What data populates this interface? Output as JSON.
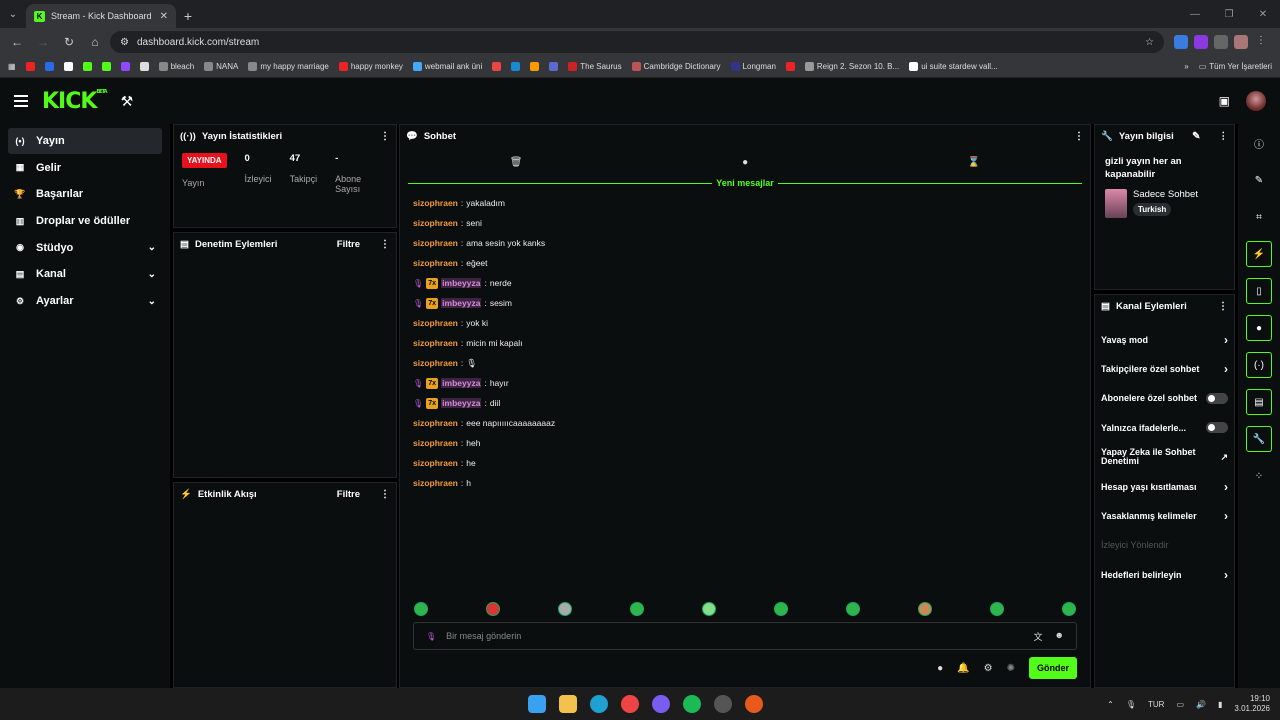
{
  "browser": {
    "tab_title": "Stream - Kick Dashboard",
    "url": "dashboard.kick.com/stream",
    "bookmarks": [
      "bleach",
      "NANA",
      "my happy marriage",
      "happy monkey",
      "webmail ank üni",
      "The Saurus",
      "Cambridge Dictionary",
      "Longman",
      "Reign 2. Sezon 10. B...",
      "ui suite stardew vall..."
    ],
    "all_bookmarks": "Tüm Yer İşaretleri"
  },
  "header": {
    "logo": "KICK",
    "beta": "BETA"
  },
  "nav": {
    "items": [
      {
        "label": "Yayın"
      },
      {
        "label": "Gelir"
      },
      {
        "label": "Başarılar"
      },
      {
        "label": "Droplar ve ödüller"
      },
      {
        "label": "Stüdyo"
      },
      {
        "label": "Kanal"
      },
      {
        "label": "Ayarlar"
      }
    ]
  },
  "stats": {
    "title": "Yayın İstatistikleri",
    "live_badge": "YAYINDA",
    "stream_label": "Yayın",
    "viewers": "0",
    "viewers_label": "İzleyici",
    "followers": "47",
    "followers_label": "Takipçi",
    "subs": "-",
    "subs_label": "Abone Sayısı"
  },
  "moderation": {
    "title": "Denetim Eylemleri",
    "filter": "Filtre"
  },
  "activity": {
    "title": "Etkinlik Akışı",
    "filter": "Filtre"
  },
  "chat": {
    "title": "Sohbet",
    "new_messages": "Yeni mesajlar",
    "messages": [
      {
        "user": "sizophraen",
        "text": "yakaladım",
        "type": "a"
      },
      {
        "user": "sizophraen",
        "text": "seni",
        "type": "a"
      },
      {
        "user": "sizophraen",
        "text": "ama sesin yok kanks",
        "type": "a"
      },
      {
        "user": "sizophraen",
        "text": "eğeet",
        "type": "a"
      },
      {
        "user": "imbeyyza",
        "text": "nerde",
        "type": "b"
      },
      {
        "user": "imbeyyza",
        "text": "sesim",
        "type": "b"
      },
      {
        "user": "sizophraen",
        "text": "yok ki",
        "type": "a"
      },
      {
        "user": "sizophraen",
        "text": "micin mi kapalı",
        "type": "a"
      },
      {
        "user": "sizophraen",
        "text": "🎙",
        "type": "a"
      },
      {
        "user": "imbeyyza",
        "text": "hayır",
        "type": "b"
      },
      {
        "user": "imbeyyza",
        "text": "diil",
        "type": "b"
      },
      {
        "user": "sizophraen",
        "text": "eee napıııııcaaaaaaaaz",
        "type": "a"
      },
      {
        "user": "sizophraen",
        "text": "heh",
        "type": "a"
      },
      {
        "user": "sizophraen",
        "text": "he",
        "type": "a"
      },
      {
        "user": "sizophraen",
        "text": "h",
        "type": "a"
      }
    ],
    "placeholder": "Bir mesaj gönderin",
    "send_label": "Gönder"
  },
  "stream_info": {
    "title": "Yayın bilgisi",
    "stream_title": "gizli yayın her an kapanabilir",
    "category": "Sadece Sohbet",
    "language": "Turkish"
  },
  "channel_actions": {
    "title": "Kanal Eylemleri",
    "items": [
      {
        "label": "Yavaş mod"
      },
      {
        "label": "Takipçilere özel sohbet"
      },
      {
        "label": "Abonelere özel sohbet"
      },
      {
        "label": "Yalnızca ifadelerle..."
      },
      {
        "label": "Yapay Zeka ile Sohbet Denetimi"
      },
      {
        "label": "Hesap yaşı kısıtlaması"
      },
      {
        "label": "Yasaklanmış kelimeler"
      },
      {
        "label": "İzleyici Yönlendir"
      },
      {
        "label": "Hedefleri belirleyin"
      }
    ]
  },
  "taskbar": {
    "lang": "TUR",
    "time": "19:10",
    "date": "3.01.2026"
  },
  "colors": {
    "accent": "#53fc18",
    "live": "#e8121d",
    "user_a": "#f59a3b",
    "user_b": "#d68ad9"
  }
}
